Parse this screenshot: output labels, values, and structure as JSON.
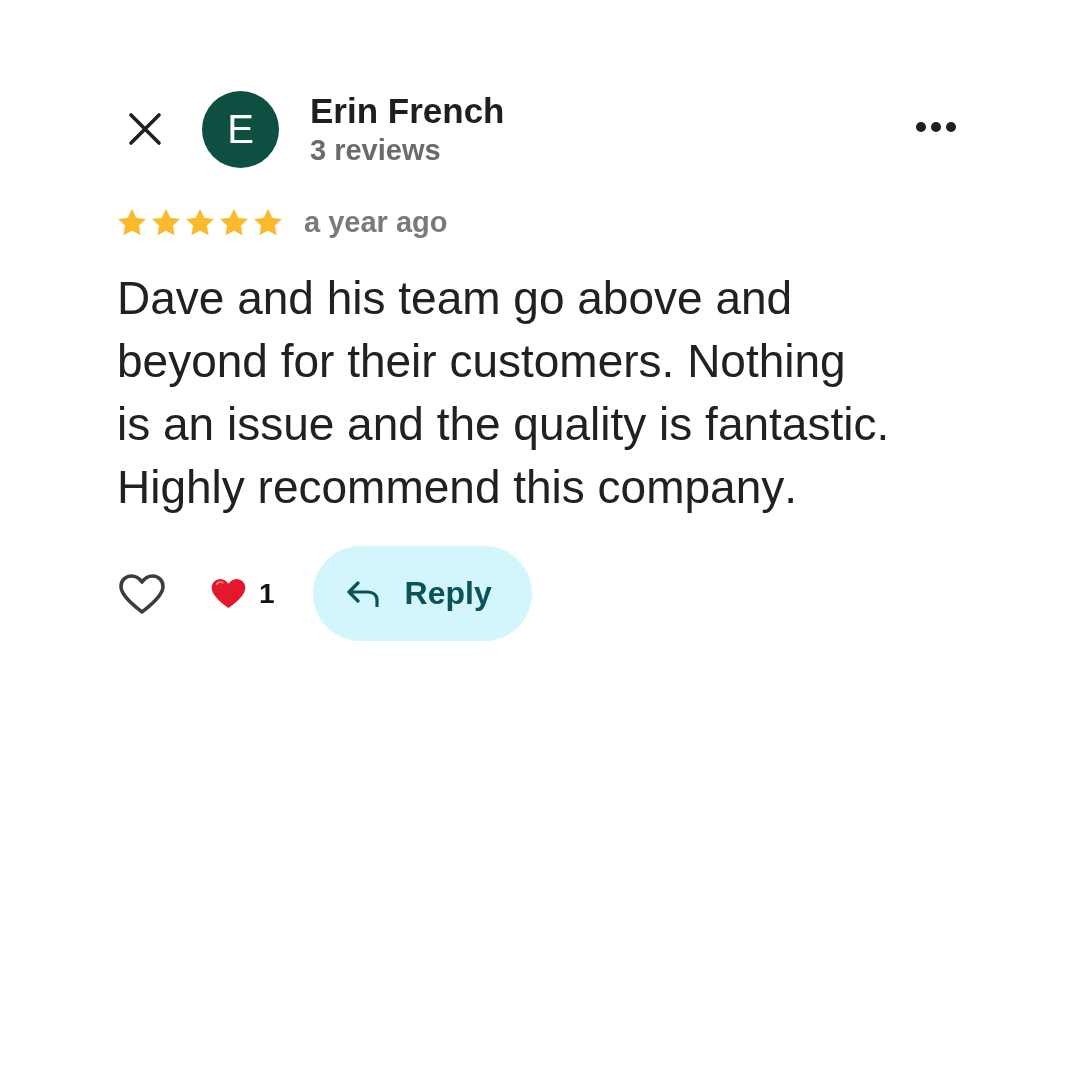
{
  "reviewer": {
    "initial": "E",
    "name": "Erin French",
    "review_count": "3 reviews"
  },
  "review": {
    "stars": 5,
    "time": "a year ago",
    "text": "Dave and his team go above and beyond for their customers. Nothing is an issue and the quality is fantastic. Highly recommend this company."
  },
  "actions": {
    "liked": false,
    "reaction_count": "1",
    "reply_label": "Reply"
  }
}
